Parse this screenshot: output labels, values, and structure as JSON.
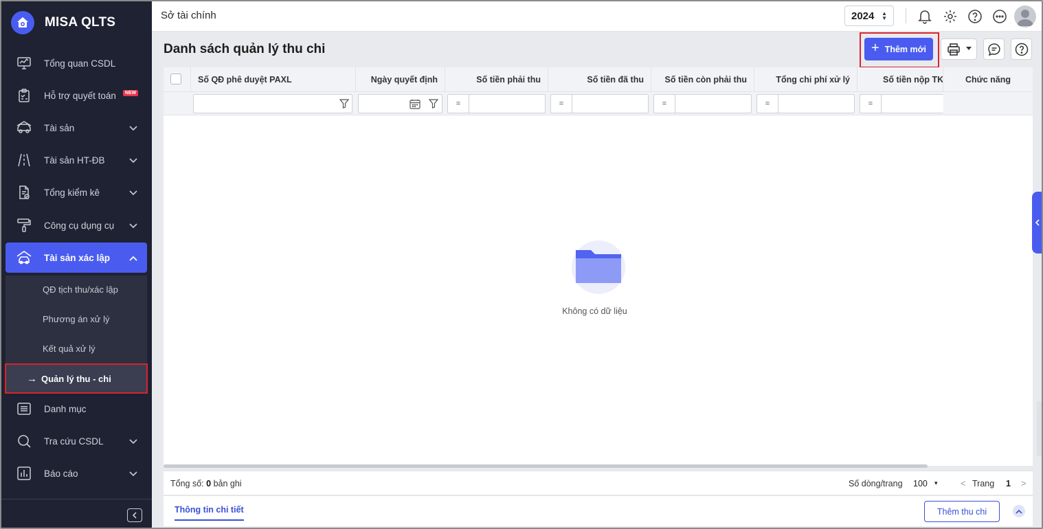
{
  "app": {
    "name": "MISA QLTS"
  },
  "sidebar": {
    "items": [
      {
        "label": "Tổng quan CSDL",
        "icon": "monitor-chart-icon"
      },
      {
        "label": "Hỗ trợ quyết toán",
        "icon": "clipboard-check-icon",
        "badge": "NEW"
      },
      {
        "label": "Tài sản",
        "icon": "car-icon"
      },
      {
        "label": "Tài sản HT-ĐB",
        "icon": "road-icon"
      },
      {
        "label": "Tổng kiểm kê",
        "icon": "document-check-icon"
      },
      {
        "label": "Công cụ dụng cụ",
        "icon": "paint-roller-icon"
      },
      {
        "label": "Tài sản xác lập",
        "icon": "car-house-icon"
      },
      {
        "label": "Danh mục",
        "icon": "list-icon"
      },
      {
        "label": "Tra cứu CSDL",
        "icon": "search-icon"
      },
      {
        "label": "Báo cáo",
        "icon": "bar-chart-icon"
      }
    ],
    "subitems": [
      {
        "label": "QĐ tịch thu/xác lập"
      },
      {
        "label": "Phương án xử lý"
      },
      {
        "label": "Kết quả xử lý"
      },
      {
        "label": "Quản lý thu - chi",
        "arrow": "→"
      }
    ]
  },
  "header": {
    "org": "Sở tài chính",
    "year": "2024"
  },
  "main": {
    "title": "Danh sách quản lý thu chi",
    "add_label": "Thêm mới",
    "columns": [
      "Số QĐ phê duyệt PAXL",
      "Ngày quyết định",
      "Số tiền phải thu",
      "Số tiền đã thu",
      "Số tiền còn phải thu",
      "Tổng chi phí xử lý",
      "Số tiền nộp TKT",
      "Chức năng"
    ],
    "filter_eq": "=",
    "empty_text": "Không có dữ liệu"
  },
  "footer": {
    "total_label": "Tổng số:",
    "total_count": "0",
    "total_unit": "bản ghi",
    "rows_label": "Số dòng/trang",
    "rows_value": "100",
    "page_label": "Trang",
    "page_num": "1"
  },
  "detail": {
    "tab_label": "Thông tin chi tiết",
    "button_label": "Thêm thu chi"
  },
  "colors": {
    "accent": "#4a5cf0",
    "sidebar_bg": "#1e2232",
    "highlight": "#d9232e"
  }
}
